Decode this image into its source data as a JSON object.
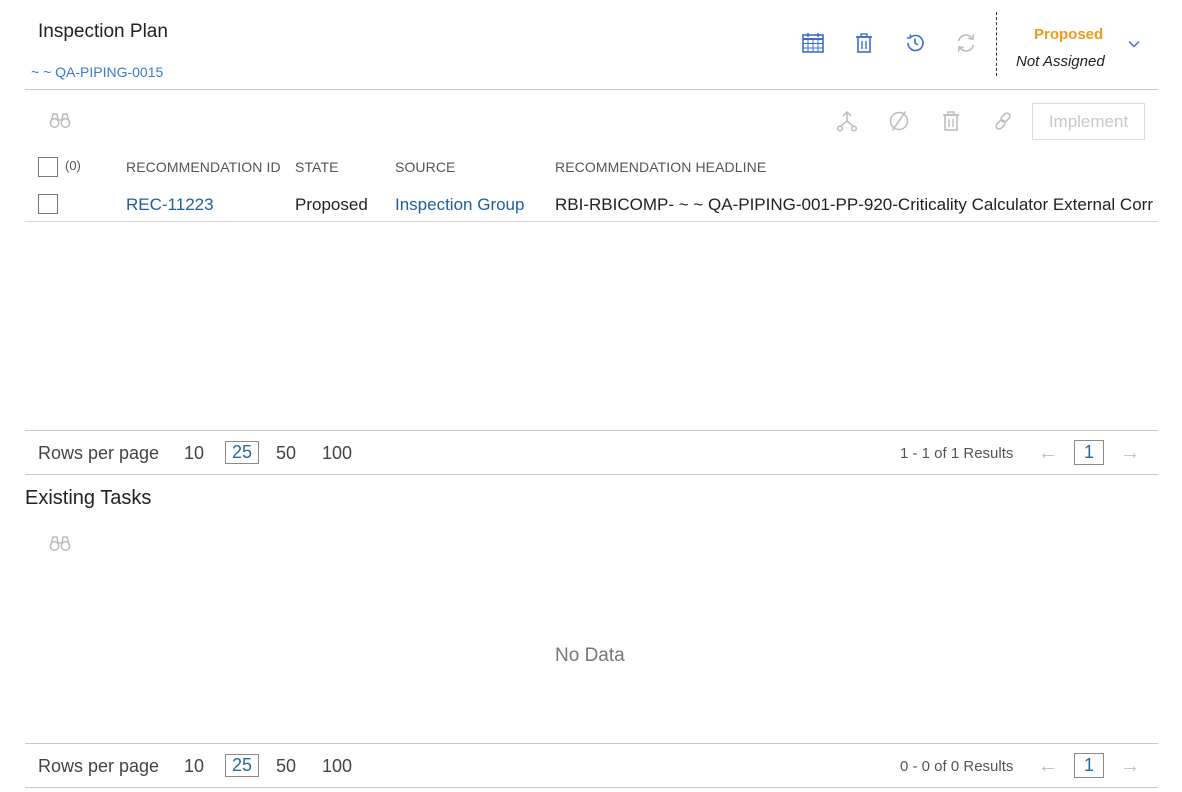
{
  "header": {
    "title": "Inspection Plan",
    "asset_link": "~ ~ QA-PIPING-0015"
  },
  "state": {
    "name": "Proposed",
    "owner": "Not Assigned"
  },
  "toolbar_icons": [
    "calendar-icon",
    "trash-icon",
    "history-icon",
    "refresh-icon"
  ],
  "recommendations": {
    "grid_icons": [
      "binoculars-icon",
      "hierarchy-icon",
      "ban-icon",
      "trash-icon",
      "link-icon"
    ],
    "implement_label": "Implement",
    "selected_count": "(0)",
    "columns": [
      "RECOMMENDATION ID",
      "STATE",
      "SOURCE",
      "RECOMMENDATION HEADLINE"
    ],
    "rows": [
      {
        "id": "REC-11223",
        "state": "Proposed",
        "source": "Inspection Group",
        "headline": "RBI-RBICOMP- ~ ~ QA-PIPING-001-PP-920-Criticality Calculator External Corr"
      }
    ],
    "pager": {
      "label": "Rows per page",
      "options": [
        "10",
        "25",
        "50",
        "100"
      ],
      "selected": "25",
      "results": "1 - 1 of 1 Results",
      "page": "1"
    }
  },
  "existing_tasks": {
    "title": "Existing Tasks",
    "empty_text": "No Data",
    "pager": {
      "label": "Rows per page",
      "options": [
        "10",
        "25",
        "50",
        "100"
      ],
      "selected": "25",
      "results": "0 - 0 of 0 Results",
      "page": "1"
    }
  },
  "colors": {
    "state_accent": "#f29a1e",
    "link": "#1f5fa0",
    "icon_active": "#3a6fd0",
    "icon_disabled": "#bcbcbc"
  }
}
